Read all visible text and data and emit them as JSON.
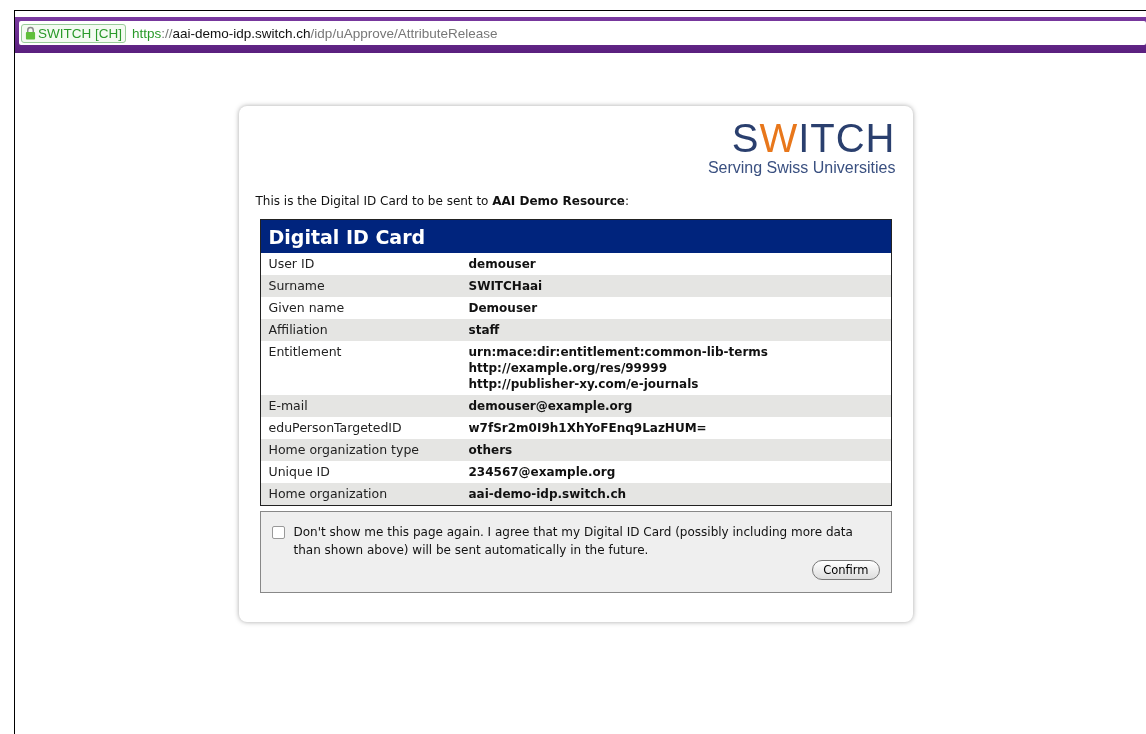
{
  "address_bar": {
    "identity": "SWITCH [CH]",
    "scheme": "https",
    "separator": "://",
    "host": "aai-demo-idp.switch.ch",
    "path": "/idp/uApprove/AttributeRelease"
  },
  "logo": {
    "name_before": "S",
    "name_accent": "W",
    "name_after": "ITCH",
    "tagline": "Serving Swiss Universities"
  },
  "intro": "This is the Digital ID Card to be sent to **AAI Demo Resource**:",
  "card": {
    "title": "Digital ID Card",
    "rows": [
      {
        "label": "User ID",
        "values": [
          "demouser"
        ]
      },
      {
        "label": "Surname",
        "values": [
          "SWITCHaai"
        ]
      },
      {
        "label": "Given name",
        "values": [
          "Demouser"
        ]
      },
      {
        "label": "Affiliation",
        "values": [
          "staff"
        ]
      },
      {
        "label": "Entitlement",
        "values": [
          "urn:mace:dir:entitlement:common-lib-terms",
          "http://example.org/res/99999",
          "http://publisher-xy.com/e-journals"
        ]
      },
      {
        "label": "E-mail",
        "values": [
          "demouser@example.org"
        ]
      },
      {
        "label": "eduPersonTargetedID",
        "values": [
          "w7fSr2m0I9h1XhYoFEnq9LazHUM="
        ]
      },
      {
        "label": "Home organization type",
        "values": [
          "others"
        ]
      },
      {
        "label": "Unique ID",
        "values": [
          "234567@example.org"
        ]
      },
      {
        "label": "Home organization",
        "values": [
          "aai-demo-idp.switch.ch"
        ]
      }
    ]
  },
  "consent": {
    "checked": false,
    "text": "Don't show me this page again. I agree that my Digital ID Card (possibly including more data than shown above) will be sent automatically in the future.",
    "button": "Confirm"
  }
}
